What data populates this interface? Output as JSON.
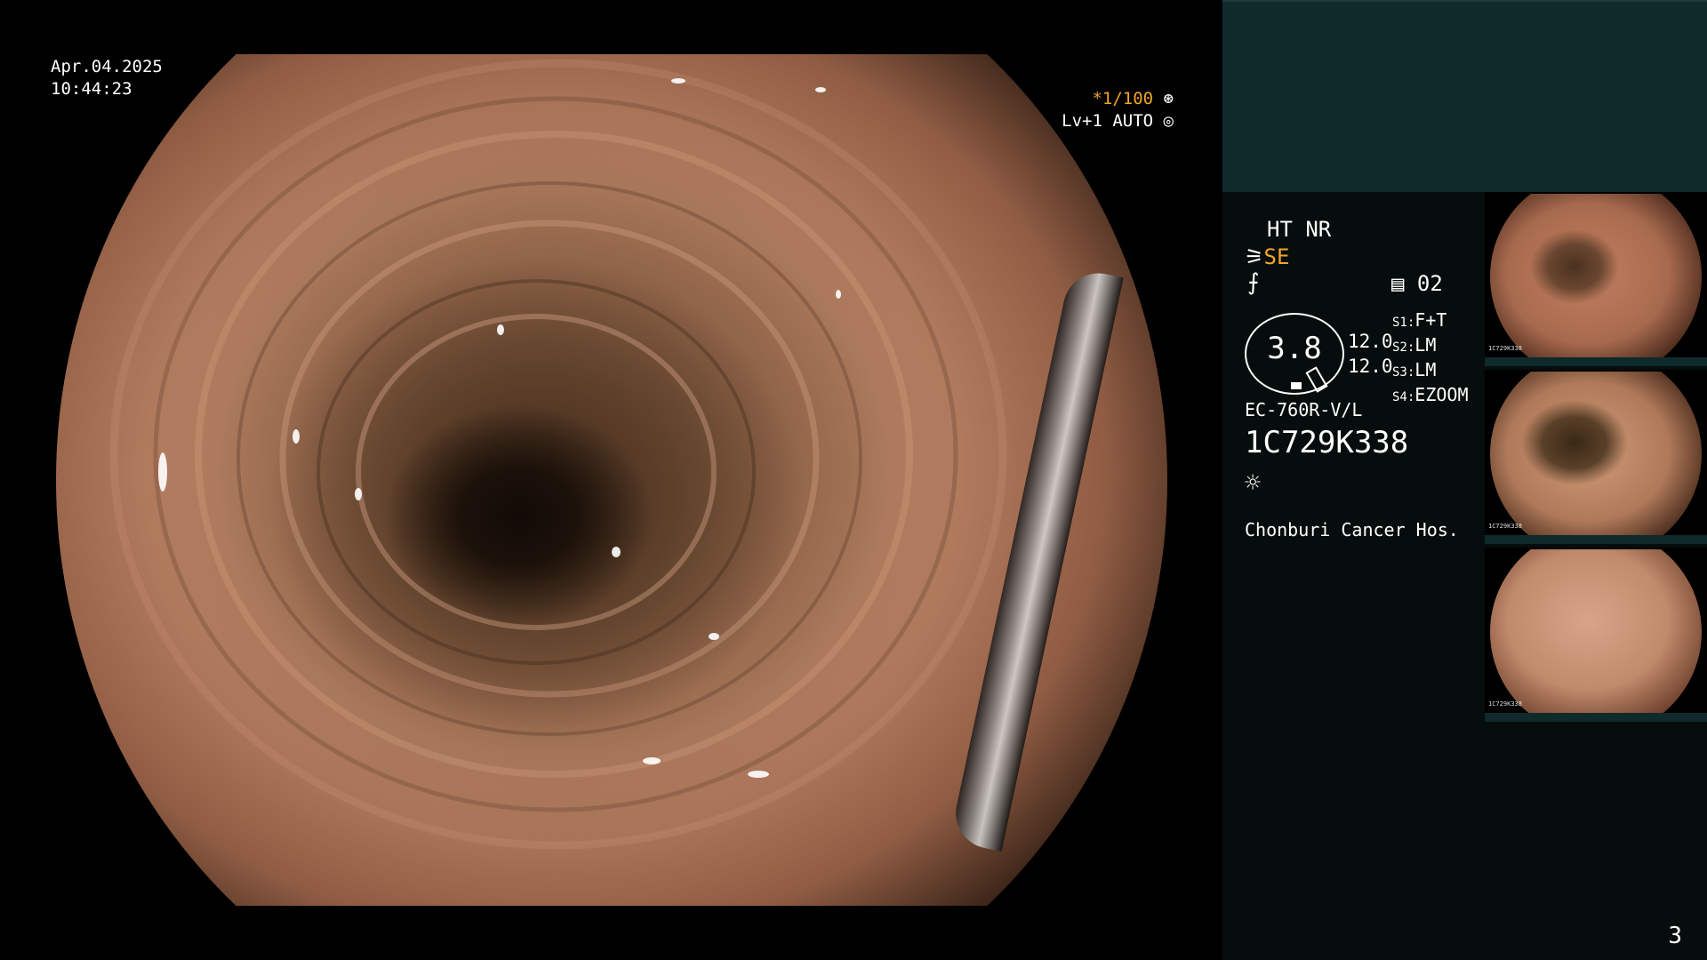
{
  "overlay": {
    "date": "Apr.04.2025",
    "time": "10:44:23",
    "shutter": "*1/100",
    "level": "Lv+1 AUTO"
  },
  "panel": {
    "ht_nr": "HT NR",
    "se": "SE",
    "sharp_glyph": "⨍",
    "storage_count": "02",
    "gauge_value": "3.8",
    "gain_1": "12.0",
    "gain_2": "12.0",
    "switches": [
      {
        "key": "S1:",
        "value": "F+T"
      },
      {
        "key": "S2:",
        "value": "LM"
      },
      {
        "key": "S3:",
        "value": "LM"
      },
      {
        "key": "S4:",
        "value": "EZOOM"
      }
    ],
    "scope_model": "EC-760R-V/L",
    "scope_serial": "1C729K338",
    "hospital": "Chonburi Cancer Hos.",
    "page_number": "3"
  },
  "thumbnails": [
    {
      "label": "1C729K338"
    },
    {
      "label": "1C729K338"
    },
    {
      "label": "1C729K338"
    }
  ],
  "icons": {
    "aperture": "aperture-icon",
    "auto": "auto-iris-icon",
    "storage": "storage-icon",
    "light": "light-icon"
  }
}
